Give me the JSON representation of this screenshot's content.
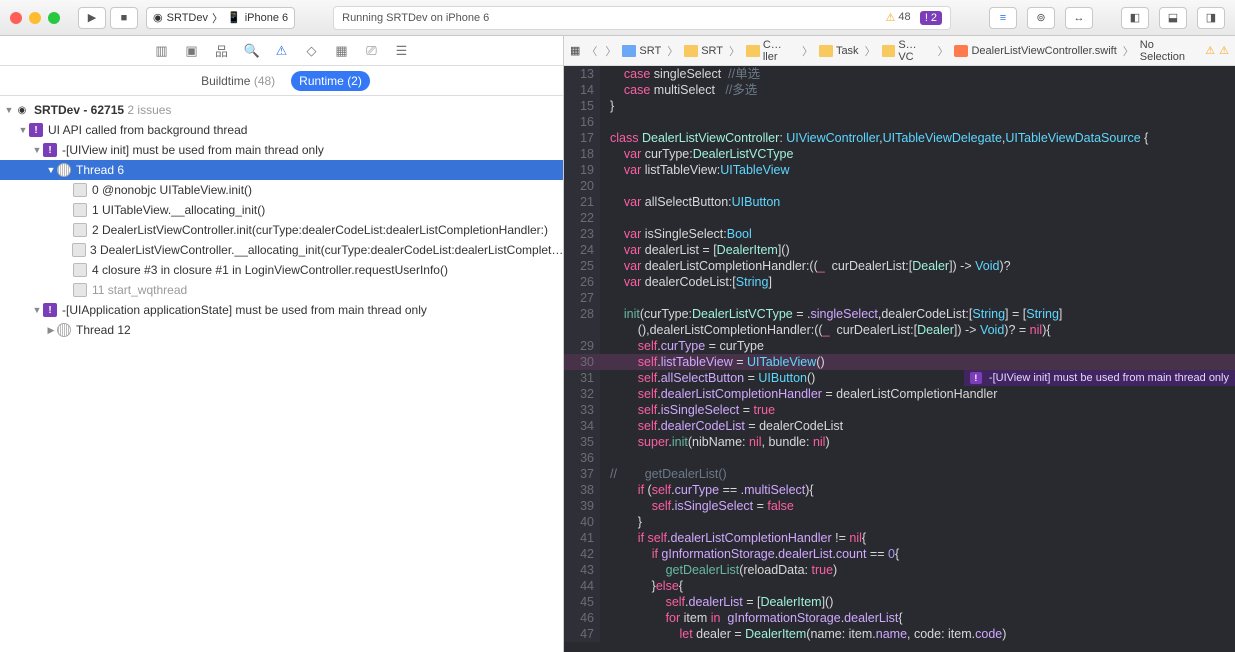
{
  "titlebar": {
    "scheme": "SRTDev",
    "device": "iPhone 6",
    "status": "Running SRTDev on iPhone 6",
    "warnings": "48",
    "errors": "2"
  },
  "navTabs": {
    "buildtime": "Buildtime",
    "buildtimeCount": "(48)",
    "runtime": "Runtime (2)"
  },
  "tree": {
    "root": "SRTDev - 62715",
    "rootSuffix": "2 issues",
    "issue1": "UI API called from background thread",
    "sub1": "-[UIView init] must be used from main thread only",
    "thread6": "Thread 6",
    "f0": "0 @nonobjc UITableView.init()",
    "f1": "1 UITableView.__allocating_init()",
    "f2": "2 DealerListViewController.init(curType:dealerCodeList:dealerListCompletionHandler:)",
    "f3": "3 DealerListViewController.__allocating_init(curType:dealerCodeList:dealerListComplet…",
    "f4": "4 closure #3 in closure #1 in LoginViewController.requestUserInfo()",
    "f11": "11 start_wqthread",
    "sub2": "-[UIApplication applicationState] must be used from main thread only",
    "thread12": "Thread 12"
  },
  "jumpbar": {
    "b1": "SRT",
    "b2": "SRT",
    "b3": "C…ller",
    "b4": "Task",
    "b5": "S…VC",
    "file": "DealerListViewController.swift",
    "sel": "No Selection"
  },
  "code": {
    "startLine": 13,
    "issueText": "-[UIView init] must be used from main thread only",
    "chart_data": null,
    "lines": [
      {
        "n": 13,
        "html": "    <span class='kw'>case</span> singleSelect  <span class='cmt'>//单选</span>"
      },
      {
        "n": 14,
        "html": "    <span class='kw'>case</span> multiSelect   <span class='cmt'>//多选</span>"
      },
      {
        "n": 15,
        "html": "}"
      },
      {
        "n": 16,
        "html": ""
      },
      {
        "n": 17,
        "html": "<span class='kw'>class</span> <span class='typeu'>DealerListViewController</span>: <span class='type'>UIViewController</span>,<span class='type'>UITableViewDelegate</span>,<span class='type'>UITableViewDataSource</span> {"
      },
      {
        "n": 18,
        "html": "    <span class='kw'>var</span> curType:<span class='typeu'>DealerListVCType</span>"
      },
      {
        "n": 19,
        "html": "    <span class='kw'>var</span> listTableView:<span class='type'>UITableView</span>"
      },
      {
        "n": 20,
        "html": ""
      },
      {
        "n": 21,
        "html": "    <span class='kw'>var</span> allSelectButton:<span class='type'>UIButton</span>"
      },
      {
        "n": 22,
        "html": ""
      },
      {
        "n": 23,
        "html": "    <span class='kw'>var</span> isSingleSelect:<span class='type'>Bool</span>"
      },
      {
        "n": 24,
        "html": "    <span class='kw'>var</span> dealerList = [<span class='typeu'>DealerItem</span>]()"
      },
      {
        "n": 25,
        "html": "    <span class='kw'>var</span> dealerListCompletionHandler:((<span class='kw'>_</span>  curDealerList:[<span class='typeu'>Dealer</span>]) -> <span class='type'>Void</span>)?"
      },
      {
        "n": 26,
        "html": "    <span class='kw'>var</span> dealerCodeList:[<span class='type'>String</span>]"
      },
      {
        "n": 27,
        "html": ""
      },
      {
        "n": 28,
        "html": "    <span class='fn'>init</span>(curType:<span class='typeu'>DealerListVCType</span> = .<span class='prop'>singleSelect</span>,dealerCodeList:[<span class='type'>String</span>] = [<span class='type'>String</span>]"
      },
      {
        "n": "",
        "html": "        (),dealerListCompletionHandler:((<span class='kw'>_</span>  curDealerList:[<span class='typeu'>Dealer</span>]) -> <span class='type'>Void</span>)? = <span class='bool'>nil</span>){"
      },
      {
        "n": 29,
        "html": "        <span class='selfk'>self</span>.<span class='prop'>curType</span> = curType"
      },
      {
        "n": 30,
        "html": "        <span class='selfk'>self</span>.<span class='prop'>listTableView</span> = <span class='type'>UITableView</span>()",
        "hl": true,
        "issue": true
      },
      {
        "n": 31,
        "html": "        <span class='selfk'>self</span>.<span class='prop'>allSelectButton</span> = <span class='type'>UIButton</span>()"
      },
      {
        "n": 32,
        "html": "        <span class='selfk'>self</span>.<span class='prop'>dealerListCompletionHandler</span> = dealerListCompletionHandler"
      },
      {
        "n": 33,
        "html": "        <span class='selfk'>self</span>.<span class='prop'>isSingleSelect</span> = <span class='bool'>true</span>"
      },
      {
        "n": 34,
        "html": "        <span class='selfk'>self</span>.<span class='prop'>dealerCodeList</span> = dealerCodeList"
      },
      {
        "n": 35,
        "html": "        <span class='kw'>super</span>.<span class='fn'>init</span>(nibName: <span class='bool'>nil</span>, bundle: <span class='bool'>nil</span>)"
      },
      {
        "n": 36,
        "html": ""
      },
      {
        "n": 37,
        "html": "<span class='cmt'>//        getDealerList()</span>"
      },
      {
        "n": 38,
        "html": "        <span class='kw'>if</span> (<span class='selfk'>self</span>.<span class='prop'>curType</span> == .<span class='prop'>multiSelect</span>){"
      },
      {
        "n": 39,
        "html": "            <span class='selfk'>self</span>.<span class='prop'>isSingleSelect</span> = <span class='bool'>false</span>"
      },
      {
        "n": 40,
        "html": "        }"
      },
      {
        "n": 41,
        "html": "        <span class='kw'>if</span> <span class='selfk'>self</span>.<span class='prop'>dealerListCompletionHandler</span> != <span class='bool'>nil</span>{"
      },
      {
        "n": 42,
        "html": "            <span class='kw'>if</span> <span class='prop'>gInformationStorage</span>.<span class='prop'>dealerList</span>.<span class='prop'>count</span> == <span class='num'>0</span>{"
      },
      {
        "n": 43,
        "html": "                <span class='fn'>getDealerList</span>(reloadData: <span class='bool'>true</span>)"
      },
      {
        "n": 44,
        "html": "            }<span class='kw'>else</span>{"
      },
      {
        "n": 45,
        "html": "                <span class='selfk'>self</span>.<span class='prop'>dealerList</span> = [<span class='typeu'>DealerItem</span>]()"
      },
      {
        "n": 46,
        "html": "                <span class='kw'>for</span> item <span class='kw'>in</span>  <span class='prop'>gInformationStorage</span>.<span class='prop'>dealerList</span>{"
      },
      {
        "n": 47,
        "html": "                    <span class='kw'>let</span> dealer = <span class='typeu'>DealerItem</span>(name: item.<span class='prop'>name</span>, code: item.<span class='prop'>code</span>)"
      }
    ]
  }
}
